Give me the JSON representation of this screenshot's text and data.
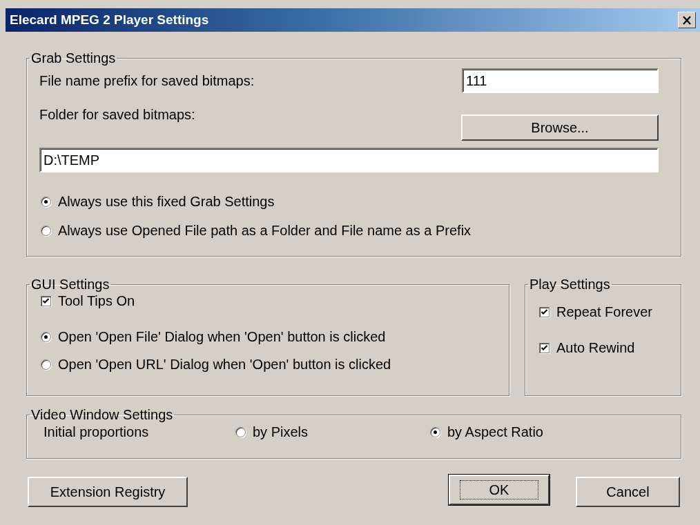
{
  "window": {
    "title": "Elecard MPEG 2 Player Settings"
  },
  "grab_settings": {
    "title": "Grab Settings",
    "prefix_label": "File name prefix for saved bitmaps:",
    "prefix_value": "111",
    "folder_label": "Folder for saved bitmaps:",
    "browse_button": "Browse...",
    "folder_value": "D:\\TEMP",
    "options": [
      {
        "label": "Always use this fixed Grab Settings",
        "selected": true
      },
      {
        "label": "Always use Opened File path as a Folder and File name as a Prefix",
        "selected": false
      }
    ]
  },
  "gui_settings": {
    "title": "GUI Settings",
    "tool_tips": {
      "label": "Tool Tips On",
      "checked": true
    },
    "options": [
      {
        "label": "Open 'Open File' Dialog when 'Open' button is clicked",
        "selected": true
      },
      {
        "label": "Open 'Open URL' Dialog when 'Open' button is clicked",
        "selected": false
      }
    ]
  },
  "play_settings": {
    "title": "Play Settings",
    "options": [
      {
        "label": "Repeat Forever",
        "checked": true
      },
      {
        "label": "Auto Rewind",
        "checked": true
      }
    ]
  },
  "video_window_settings": {
    "title": "Video Window Settings",
    "label": "Initial proportions",
    "options": [
      {
        "label": "by Pixels",
        "selected": false
      },
      {
        "label": "by Aspect Ratio",
        "selected": true
      }
    ]
  },
  "buttons": [
    {
      "label": "Extension Registry",
      "kind": "plain"
    },
    {
      "label": "OK",
      "kind": "default"
    },
    {
      "label": "Cancel",
      "kind": "plain"
    }
  ]
}
